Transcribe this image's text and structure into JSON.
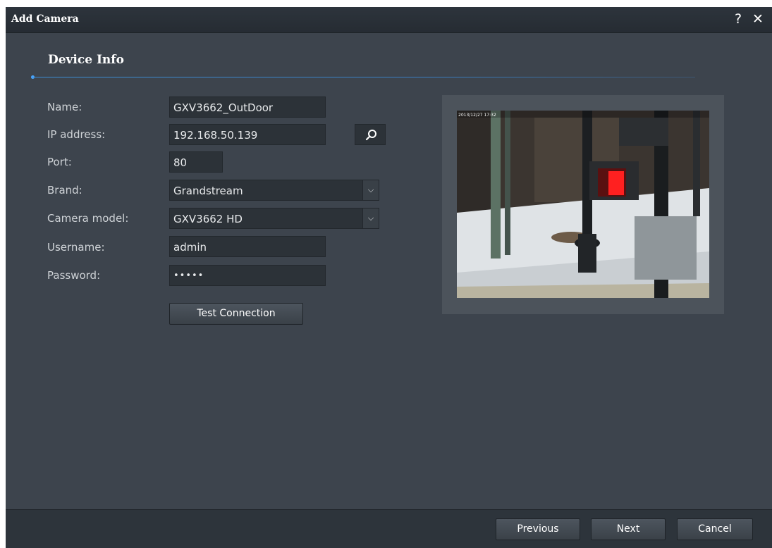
{
  "dialog": {
    "title": "Add Camera",
    "help_icon": "help-icon",
    "close_icon": "close-icon"
  },
  "section": {
    "title": "Device Info"
  },
  "form": {
    "name_label": "Name:",
    "name_value": "GXV3662_OutDoor",
    "ip_label": "IP address:",
    "ip_value": "192.168.50.139",
    "search_icon": "search-icon",
    "port_label": "Port:",
    "port_value": "80",
    "brand_label": "Brand:",
    "brand_value": "Grandstream",
    "model_label": "Camera model:",
    "model_value": "GXV3662 HD",
    "username_label": "Username:",
    "username_value": "admin",
    "password_label": "Password:",
    "password_value": "•••••",
    "test_button": "Test Connection"
  },
  "preview": {
    "timestamp": "2013/12/27 17:32"
  },
  "footer": {
    "previous": "Previous",
    "next": "Next",
    "cancel": "Cancel"
  },
  "colors": {
    "background": "#3d444d",
    "titlebar": "#262c33",
    "accent_line": "#3d8fd6",
    "field_bg": "#2c3238"
  }
}
